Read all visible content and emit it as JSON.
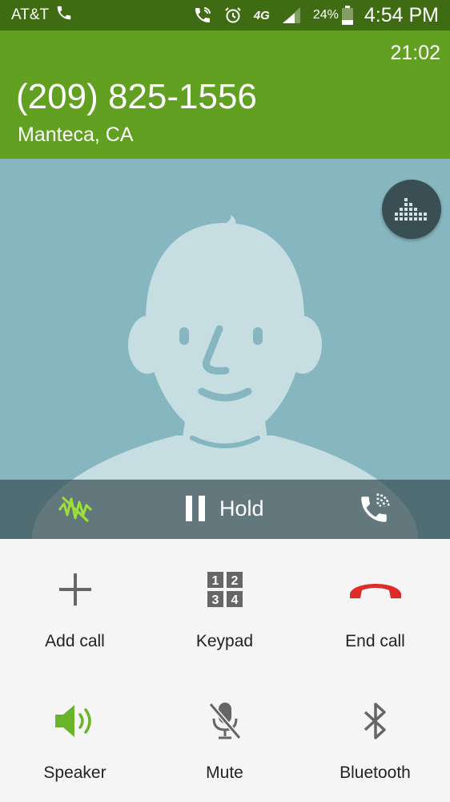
{
  "status_bar": {
    "carrier": "AT&T",
    "network": "4G",
    "battery": "24%",
    "time": "4:54 PM"
  },
  "call": {
    "duration": "21:02",
    "number": "(209) 825-1556",
    "location": "Manteca, CA"
  },
  "strip": {
    "hold_label": "Hold"
  },
  "controls": {
    "add_call": "Add call",
    "keypad": "Keypad",
    "end_call": "End call",
    "speaker": "Speaker",
    "mute": "Mute",
    "bluetooth": "Bluetooth"
  },
  "keypad_digits": [
    "1",
    "2",
    "3",
    "4"
  ],
  "colors": {
    "status_bar": "#3f6b12",
    "header": "#62a022",
    "avatar_bg": "#86b7c1",
    "end_call_red": "#e02b2b",
    "speaker_green": "#6ab32a",
    "noise_reduction_green": "#9ee03a"
  },
  "icons": [
    "phone-icon",
    "wifi-call-icon",
    "alarm-icon",
    "signal-icon",
    "battery-icon",
    "equalizer-icon",
    "noise-reduction-icon",
    "pause-icon",
    "call-handoff-icon",
    "plus-icon",
    "keypad-icon",
    "end-call-icon",
    "speaker-icon",
    "mute-icon",
    "bluetooth-icon"
  ]
}
